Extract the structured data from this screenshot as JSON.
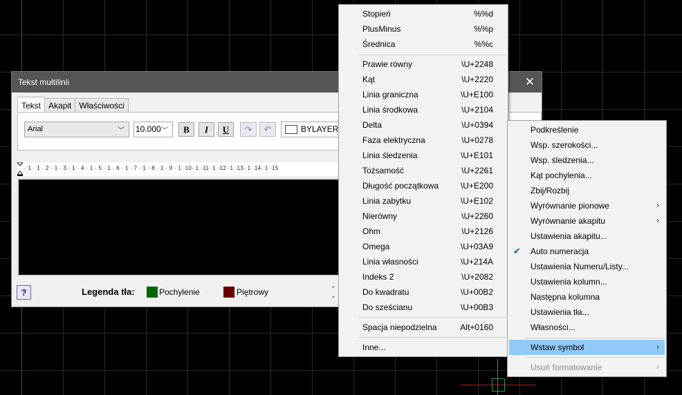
{
  "dialog": {
    "title": "Tekst multilinii",
    "tabs": [
      "Tekst",
      "Akapit",
      "Właściwości"
    ],
    "font": "Arial",
    "size": "10.000",
    "bold": "B",
    "italic": "I",
    "underline": "U",
    "undo": "↶",
    "redo": "↷",
    "color": "BYLAYER",
    "ruler_text": "· 1 · 1 · 2 · 1 · 3 · 1 · 4 · 1 · 5 · 1 · 6 · 1 · 7 · 1 · 8 · 1 · 9 · 1 ·10· 1 ·11· 1 ·12· 1 ·13· 1 ·14· 1 ·15",
    "help": "?",
    "legend_label": "Legenda tła:",
    "legend": [
      {
        "label": "Pochylenie",
        "color": "#006400"
      },
      {
        "label": "Piętrowy",
        "color": "#6b0000"
      }
    ]
  },
  "symbol_menu": {
    "items": [
      {
        "label": "Stopień",
        "code": "%%d"
      },
      {
        "label": "PlusMinus",
        "code": "%%p"
      },
      {
        "label": "Średnica",
        "code": "%%c"
      },
      {
        "label": "Prawie równy",
        "code": "\\U+2248"
      },
      {
        "label": "Kąt",
        "code": "\\U+2220"
      },
      {
        "label": "Linia graniczna",
        "code": "\\U+E100"
      },
      {
        "label": "Linia środkowa",
        "code": "\\U+2104"
      },
      {
        "label": "Delta",
        "code": "\\U+0394"
      },
      {
        "label": "Faza elektryczna",
        "code": "\\U+0278"
      },
      {
        "label": "Linia śledzenia",
        "code": "\\U+E101"
      },
      {
        "label": "Tożsamość",
        "code": "\\U+2261"
      },
      {
        "label": "Długość początkowa",
        "code": "\\U+E200"
      },
      {
        "label": "Linia zabytku",
        "code": "\\U+E102"
      },
      {
        "label": "Nierówny",
        "code": "\\U+2260"
      },
      {
        "label": "Ohm",
        "code": "\\U+2126"
      },
      {
        "label": "Omega",
        "code": "\\U+03A9"
      },
      {
        "label": "Linia własności",
        "code": "\\U+214A"
      },
      {
        "label": "Indeks 2",
        "code": "\\U+2082"
      },
      {
        "label": "Do kwadratu",
        "code": "\\U+00B2"
      },
      {
        "label": "Do sześcianu",
        "code": "\\U+00B3"
      },
      {
        "label": "Spacja niepodzielna",
        "code": "Alt+0160"
      },
      {
        "label": "Inne...",
        "code": ""
      }
    ]
  },
  "context_menu": {
    "items": [
      {
        "label": "Podkreślenie"
      },
      {
        "label": "Wsp. szerokości..."
      },
      {
        "label": "Wsp. śledzenia..."
      },
      {
        "label": "Kąt pochylenia..."
      },
      {
        "label": "Zbij/Rozbij"
      },
      {
        "label": "Wyrównanie pionowe",
        "arrow": "›"
      },
      {
        "label": "Wyrównanie akapitu",
        "arrow": "›"
      },
      {
        "label": "Ustawienia akapitu..."
      },
      {
        "label": "Auto numeracja",
        "check": "✔"
      },
      {
        "label": "Ustawienia Numeru/Listy..."
      },
      {
        "label": "Ustawienia kolumn..."
      },
      {
        "label": "Następna kolumna"
      },
      {
        "label": "Ustawienia tła..."
      },
      {
        "label": "Własności..."
      },
      {
        "label": "Wstaw symbol",
        "arrow": "›"
      },
      {
        "label": "Usuń formatowanie",
        "arrow": "›"
      }
    ]
  }
}
